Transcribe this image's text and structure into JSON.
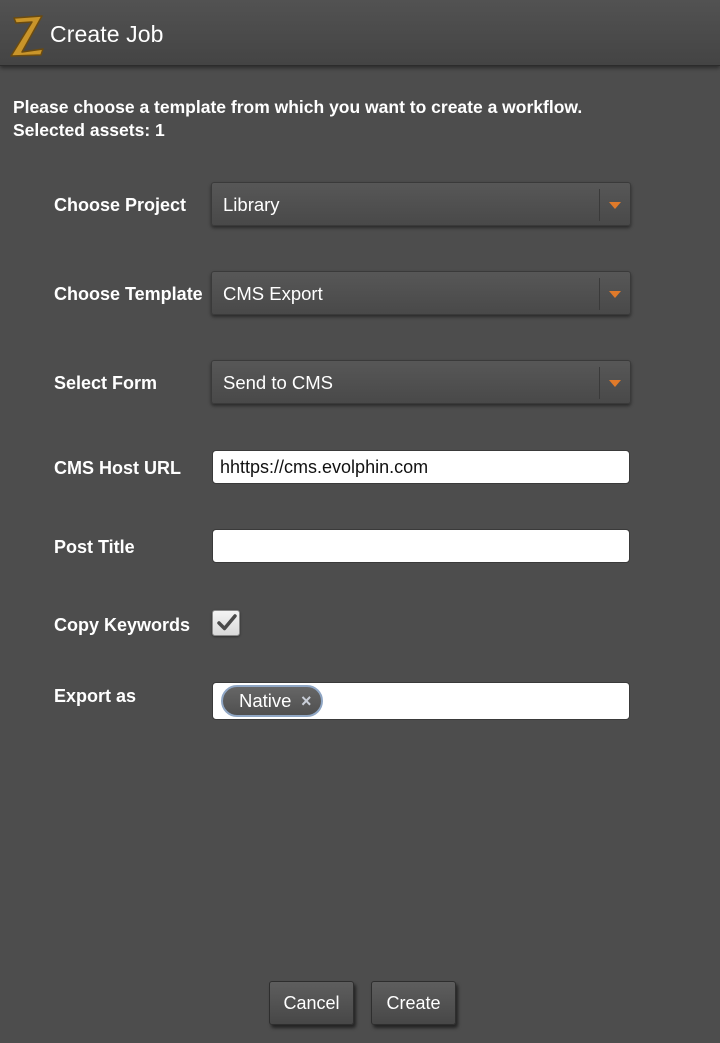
{
  "window": {
    "title": "Create Job"
  },
  "intro": {
    "line1": "Please choose a template from which you want to create a workflow.",
    "line2": "Selected assets: 1"
  },
  "form": {
    "project": {
      "label": "Choose Project",
      "value": "Library"
    },
    "template": {
      "label": "Choose Template",
      "value": "CMS Export"
    },
    "form_select": {
      "label": "Select Form",
      "value": "Send to CMS"
    },
    "cms_host_url": {
      "label": "CMS Host URL",
      "value": "hhttps://cms.evolphin.com"
    },
    "post_title": {
      "label": "Post Title",
      "value": ""
    },
    "copy_keywords": {
      "label": "Copy Keywords",
      "checked": true
    },
    "export_as": {
      "label": "Export as",
      "tags": [
        "Native"
      ]
    }
  },
  "buttons": {
    "cancel": "Cancel",
    "create": "Create"
  },
  "icons": {
    "logo": "zoom-logo-icon",
    "dropdown": "chevron-down-icon",
    "check": "checkmark-icon",
    "remove": "close-icon"
  },
  "colors": {
    "background": "#4d4d4d",
    "accent_arrow": "#e07a2a",
    "tag_border": "#8fa6c4"
  }
}
